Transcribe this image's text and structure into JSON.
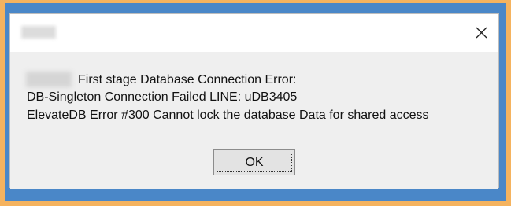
{
  "dialog": {
    "title": "",
    "close_icon": "close-icon",
    "message_lines": [
      "First stage Database Connection Error:",
      "DB-Singleton Connection Failed LINE: uDB3405",
      "ElevateDB Error #300 Cannot lock the database Data for shared access"
    ],
    "ok_label": "OK"
  }
}
